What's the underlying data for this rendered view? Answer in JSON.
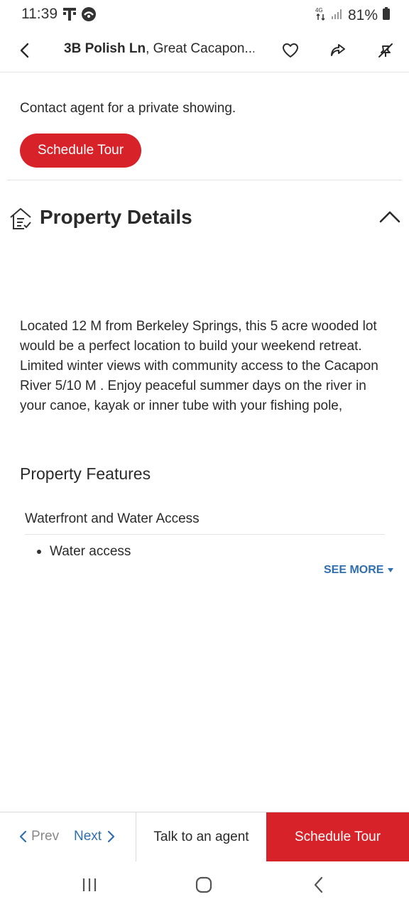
{
  "status_bar": {
    "time": "11:39",
    "battery": "81%"
  },
  "header": {
    "title_bold": "3B Polish Ln",
    "title_rest": ", Great Cacapon..."
  },
  "contact": {
    "text": "Contact agent for a private showing.",
    "button_label": "Schedule Tour"
  },
  "property_details": {
    "title": "Property Details",
    "description": "Located 12 M from Berkeley Springs, this 5 acre wooded lot would be a perfect location to build your weekend retreat. Limited winter views with community access to the Cacapon River 5/10 M . Enjoy peaceful summer days on the river in your canoe, kayak or inner tube with your fishing pole,",
    "features_title": "Property Features",
    "feature_groups": [
      {
        "name": "Waterfront and Water Access",
        "items": [
          "Water access"
        ]
      }
    ],
    "see_more_label": "SEE MORE"
  },
  "action_bar": {
    "prev_label": "Prev",
    "next_label": "Next",
    "talk_label": "Talk to an agent",
    "tour_label": "Schedule Tour"
  },
  "colors": {
    "brand_red": "#d72229",
    "link_blue": "#2f6fb0",
    "text": "#2a2a2a"
  },
  "icons": [
    "t-mobile-icon",
    "game-icon",
    "data-icon",
    "signal-icon",
    "battery-icon",
    "back-icon",
    "heart-icon",
    "share-icon",
    "hide-icon",
    "house-list-icon",
    "chevron-up-icon",
    "triangle-down-icon",
    "chevron-left-icon",
    "chevron-right-icon",
    "recents-icon",
    "home-icon",
    "back-nav-icon"
  ]
}
